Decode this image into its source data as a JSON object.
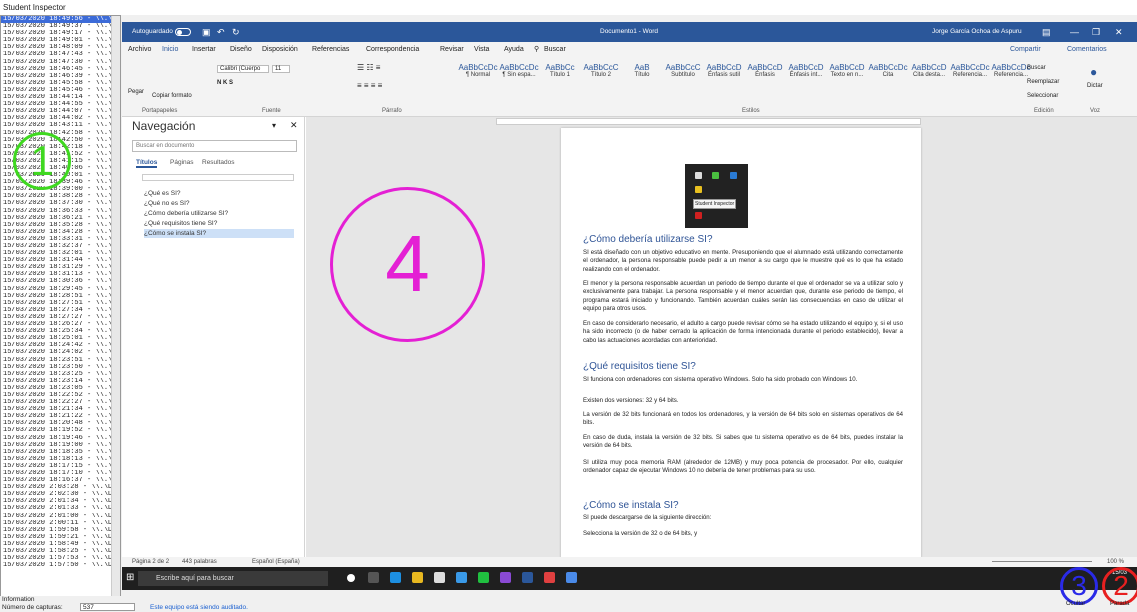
{
  "app_title": "Student Inspector",
  "log_entries": [
    "15/03/2020 18:49:56 - \\\\.\\DISPLA",
    "15/03/2020 18:49:37 - \\\\.\\DISPLA",
    "15/03/2020 18:49:17 - \\\\.\\DISPLA",
    "15/03/2020 18:49:01 - \\\\.\\DISPLA",
    "15/03/2020 18:48:09 - \\\\.\\DISPLA",
    "15/03/2020 18:47:43 - \\\\.\\DISPLA",
    "15/03/2020 18:47:30 - \\\\.\\DISPLA",
    "15/03/2020 18:46:45 - \\\\.\\DISPLA",
    "15/03/2020 18:46:39 - \\\\.\\DISPLA",
    "15/03/2020 18:45:58 - \\\\.\\DISPLA",
    "15/03/2020 18:45:46 - \\\\.\\DISPLA",
    "15/03/2020 18:44:14 - \\\\.\\DISPLA",
    "15/03/2020 18:44:55 - \\\\.\\DISPLA",
    "15/03/2020 18:44:07 - \\\\.\\DISPLA",
    "15/03/2020 18:44:02 - \\\\.\\DISPLA",
    "15/03/2020 18:43:11 - \\\\.\\DISPLA",
    "15/03/2020 18:42:58 - \\\\.\\DISPLA",
    "15/03/2020 18:42:50 - \\\\.\\DISPLA",
    "15/03/2020 18:42:18 - \\\\.\\DISPLA",
    "15/03/2020 18:41:52 - \\\\.\\DISPLA",
    "15/03/2020 18:41:15 - \\\\.\\DISPLA",
    "15/03/2020 18:40:06 - \\\\.\\DISPLA",
    "15/03/2020 18:40:01 - \\\\.\\DISPLA",
    "15/03/2020 18:39:46 - \\\\.\\DISPLA",
    "15/03/2020 18:39:00 - \\\\.\\DISPLA",
    "15/03/2020 18:38:28 - \\\\.\\DISPLA",
    "15/03/2020 18:37:30 - \\\\.\\DISPLA",
    "15/03/2020 18:36:33 - \\\\.\\DISPLA",
    "15/03/2020 18:36:21 - \\\\.\\DISPLA",
    "15/03/2020 18:35:28 - \\\\.\\DISPLA",
    "15/03/2020 18:34:28 - \\\\.\\DISPLA",
    "15/03/2020 18:33:31 - \\\\.\\DISPLA",
    "15/03/2020 18:32:37 - \\\\.\\DISPLA",
    "15/03/2020 18:32:01 - \\\\.\\DISPLA",
    "15/03/2020 18:31:44 - \\\\.\\DISPLA",
    "15/03/2020 18:31:29 - \\\\.\\DISPLA",
    "15/03/2020 18:31:13 - \\\\.\\DISPLA",
    "15/03/2020 18:30:36 - \\\\.\\DISPLA",
    "15/03/2020 18:29:45 - \\\\.\\DISPLA",
    "15/03/2020 18:28:51 - \\\\.\\DISPLA",
    "15/03/2020 18:27:51 - \\\\.\\DISPLA",
    "15/03/2020 18:27:34 - \\\\.\\DISPLA",
    "15/03/2020 18:27:27 - \\\\.\\DISPLA",
    "15/03/2020 18:26:27 - \\\\.\\DISPLA",
    "15/03/2020 18:25:34 - \\\\.\\DISPLA",
    "15/03/2020 18:25:01 - \\\\.\\DISPLA",
    "15/03/2020 18:24:42 - \\\\.\\DISPLA",
    "15/03/2020 18:24:02 - \\\\.\\DISPLA",
    "15/03/2020 18:23:51 - \\\\.\\DISPLA",
    "15/03/2020 18:23:50 - \\\\.\\DISPLA",
    "15/03/2020 18:23:25 - \\\\.\\DISPLA",
    "15/03/2020 18:23:14 - \\\\.\\DISPLA",
    "15/03/2020 18:23:05 - \\\\.\\DISPLA",
    "15/03/2020 18:22:52 - \\\\.\\DISPLA",
    "15/03/2020 18:22:27 - \\\\.\\DISPLA",
    "15/03/2020 18:21:34 - \\\\.\\DISPLA",
    "15/03/2020 18:21:22 - \\\\.\\DISPLA",
    "15/03/2020 18:20:48 - \\\\.\\DISPLA",
    "15/03/2020 18:19:52 - \\\\.\\DISPLA",
    "15/03/2020 18:19:46 - \\\\.\\DISPLA",
    "15/03/2020 18:19:00 - \\\\.\\DISPLA",
    "15/03/2020 18:18:35 - \\\\.\\DISPLA",
    "15/03/2020 18:18:13 - \\\\.\\DISPLA",
    "15/03/2020 18:17:15 - \\\\.\\DISPLA",
    "15/03/2020 18:17:10 - \\\\.\\DISPLA",
    "15/03/2020 18:16:37 - \\\\.\\DISPLA",
    "15/03/2020 2:03:28 - \\\\.\\DISPLAY",
    "15/03/2020 2:02:30 - \\\\.\\DISPLAY",
    "15/03/2020 2:01:34 - \\\\.\\DISPLAY",
    "15/03/2020 2:01:33 - \\\\.\\DISPLAY",
    "15/03/2020 2:01:00 - \\\\.\\DISPLAY",
    "15/03/2020 2:00:11 - \\\\.\\DISPLAY",
    "15/03/2020 1:59:58 - \\\\.\\DISPLAY",
    "15/03/2020 1:59:21 - \\\\.\\DISPLAY",
    "15/03/2020 1:58:49 - \\\\.\\DISPLAY",
    "15/03/2020 1:58:25 - \\\\.\\DISPLAY",
    "15/03/2020 1:57:53 - \\\\.\\DISPLAY",
    "15/03/2020 1:57:50 - \\\\.\\DISPLAY"
  ],
  "bottom": {
    "info_label": "Information",
    "captures_label": "Número de capturas:",
    "captures_value": "537",
    "audit_text": "Este equipo está siendo auditado."
  },
  "word": {
    "autosave": "Autoguardado",
    "doc_title": "Documento1 - Word",
    "user": "Jorge García Ochoa de Aspuru",
    "tabs": [
      "Archivo",
      "Inicio",
      "Insertar",
      "Diseño",
      "Disposición",
      "Referencias",
      "Correspondencia",
      "Revisar",
      "Vista",
      "Ayuda",
      "Buscar"
    ],
    "share": "Compartir",
    "comments": "Comentarios",
    "groups": [
      "Portapapeles",
      "Fuente",
      "Párrafo",
      "Estilos",
      "Edición",
      "Voz"
    ],
    "paste": "Pegar",
    "copy_format": "Copiar formato",
    "font": "Calibri (Cuerpo",
    "font_size": "11",
    "styles": [
      {
        "p": "AaBbCcDc",
        "n": "¶ Normal"
      },
      {
        "p": "AaBbCcDc",
        "n": "¶ Sin espa..."
      },
      {
        "p": "AaBbCc",
        "n": "Título 1"
      },
      {
        "p": "AaBbCcC",
        "n": "Título 2"
      },
      {
        "p": "AaB",
        "n": "Título"
      },
      {
        "p": "AaBbCcC",
        "n": "Subtítulo"
      },
      {
        "p": "AaBbCcD",
        "n": "Énfasis sutil"
      },
      {
        "p": "AaBbCcD",
        "n": "Énfasis"
      },
      {
        "p": "AaBbCcD",
        "n": "Énfasis int..."
      },
      {
        "p": "AaBbCcD",
        "n": "Texto en n..."
      },
      {
        "p": "AaBbCcDc",
        "n": "Cita"
      },
      {
        "p": "AaBbCcD",
        "n": "Cita desta..."
      },
      {
        "p": "AaBbCcDc",
        "n": "Referencia..."
      },
      {
        "p": "AaBbCcDc",
        "n": "Referencia..."
      }
    ],
    "edit": [
      "Buscar",
      "Reemplazar",
      "Seleccionar"
    ],
    "dictate": "Dictar"
  },
  "nav": {
    "title": "Navegación",
    "search_placeholder": "Buscar en documento",
    "tabs": [
      "Títulos",
      "Páginas",
      "Resultados"
    ],
    "items": [
      "¿Qué es SI?",
      "¿Qué no es SI?",
      "¿Cómo debería utilizarse SI?",
      "¿Qué requisitos tiene SI?",
      "¿Cómo se instala SI?"
    ]
  },
  "doc": {
    "tooltip": "Student Inspector",
    "h1": "¿Cómo debería utilizarse SI?",
    "p1": "SI está diseñado con un objetivo educativo en mente. Presuponiendo que el alumnado está utilizando correctamente el ordenador, la persona responsable puede pedir a un menor a su cargo que le muestre qué es lo que ha estado realizando con el ordenador.",
    "p2": "El menor y la persona responsable acuerdan un periodo de tiempo durante el que el ordenador se va a utilizar solo y exclusivamente para trabajar. La persona responsable y el menor acuerdan que, durante ese periodo de tiempo, el programa estará iniciado y funcionando. También acuerdan cuáles serán las consecuencias en caso de utilizar el equipo para otros usos.",
    "p3": "En caso de considerarlo necesario, el adulto a cargo puede revisar cómo se ha estado utilizando el equipo y, si el uso ha sido incorrecto (o de haber cerrado la aplicación de forma intencionada durante el periodo establecido), llevar a cabo las actuaciones acordadas con anterioridad.",
    "h2": "¿Qué requisitos tiene SI?",
    "p4": "SI funciona con ordenadores con sistema operativo Windows. Solo ha sido probado con Windows 10.",
    "p5": "Existen dos versiones: 32 y 64 bits.",
    "p6": "La versión de 32 bits funcionará en todos los ordenadores, y la versión de 64 bits solo en sistemas operativos de 64 bits.",
    "p7": "En caso de duda, instala la versión de 32 bits. Si sabes que tu sistema operativo es de 64 bits, puedes instalar la versión de 64 bits.",
    "p8": "SI utiliza muy poca memoria RAM (alrededor de 12MB) y muy poca potencia de procesador. Por ello, cualquier ordenador capaz de ejecutar Windows 10 no debería de tener problemas para su uso.",
    "h3": "¿Cómo se instala SI?",
    "p9": "SI puede descargarse de la siguiente dirección:",
    "p10": "Selecciona la versión de 32 o de 64 bits, y"
  },
  "status": {
    "page": "Página 2 de 2",
    "words": "443 palabras",
    "lang": "Español (España)",
    "zoom": "100 %"
  },
  "taskbar": {
    "search": "Escribe aquí para buscar",
    "time": "15/03"
  },
  "annotations": {
    "a1": "1",
    "a2": "2",
    "a3": "3",
    "a4": "4",
    "ocultar": "Ocultar",
    "parada": "Parada"
  }
}
